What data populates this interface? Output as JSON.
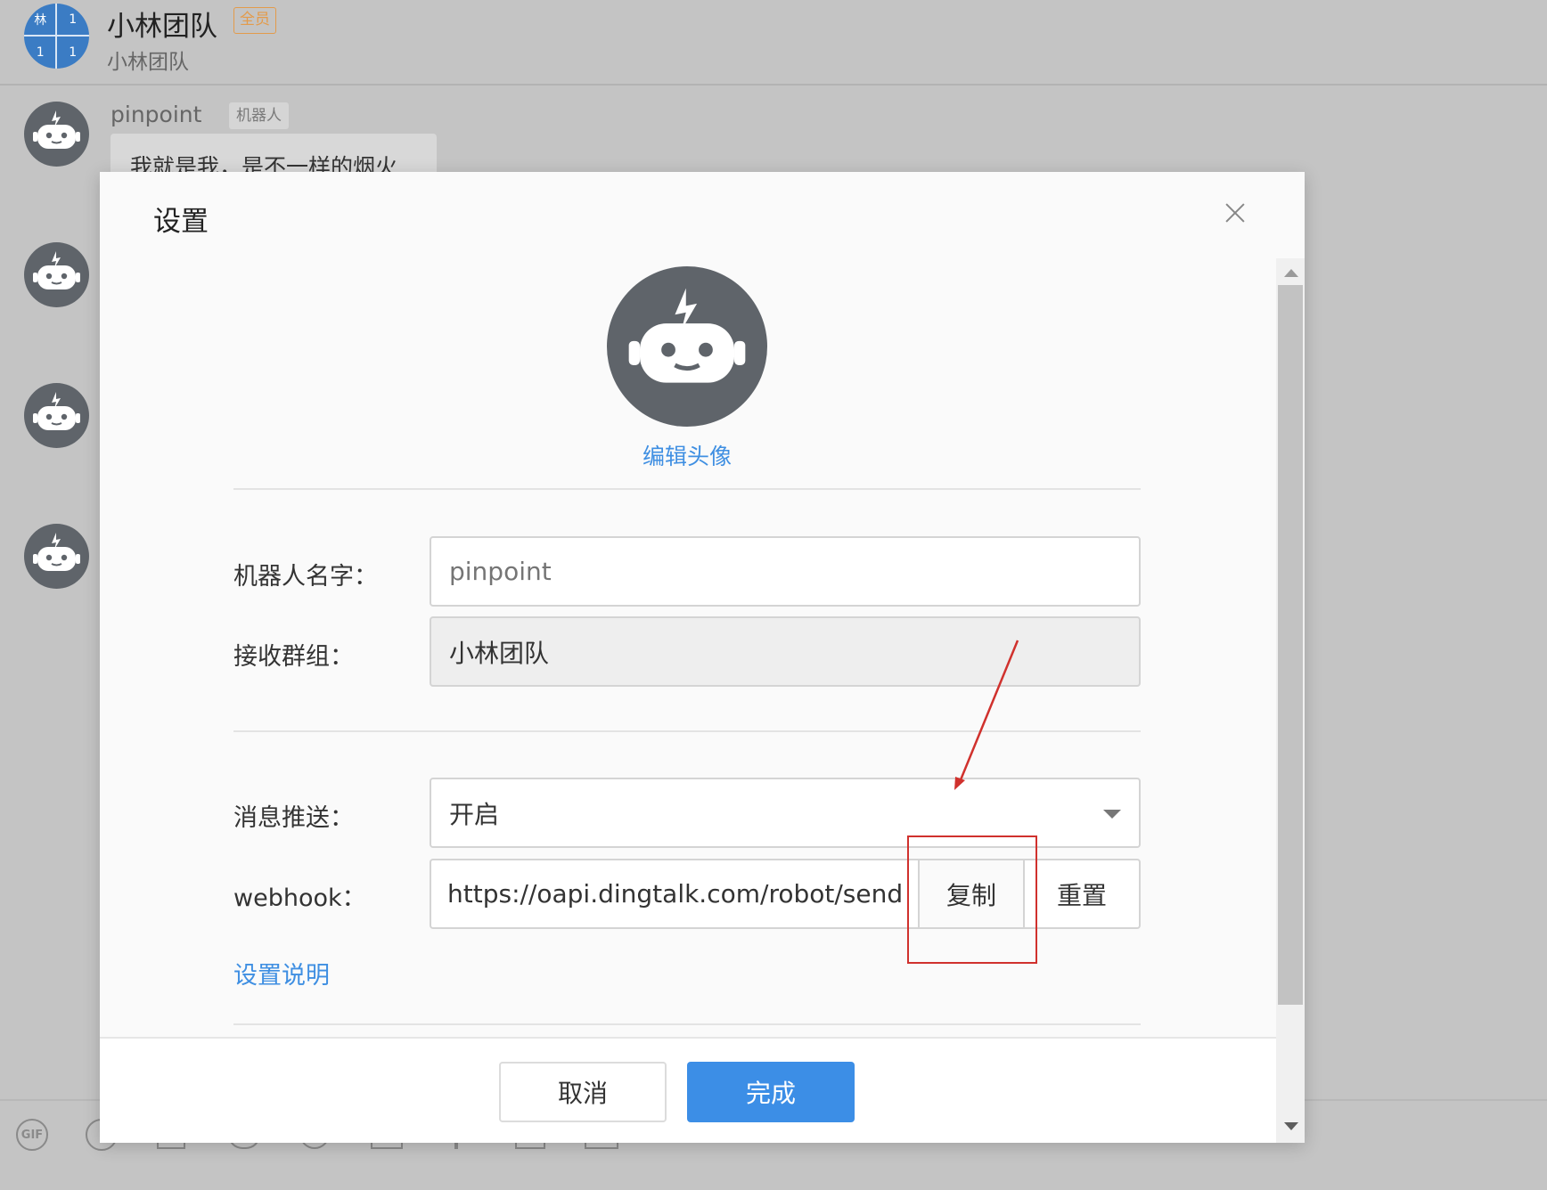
{
  "header": {
    "group_avatar_cells": [
      "林",
      "1",
      "1",
      "1"
    ],
    "title": "小林团队",
    "member_badge": "全员",
    "subtitle": "小林团队"
  },
  "message": {
    "sender": "pinpoint",
    "sender_tag": "机器人",
    "text": "我就是我，是不一样的烟火"
  },
  "toolbar": {
    "gif_label": "GIF"
  },
  "dialog": {
    "title": "设置",
    "edit_avatar": "编辑头像",
    "robot_name": {
      "label": "机器人名字：",
      "placeholder": "pinpoint"
    },
    "receive_group": {
      "label": "接收群组：",
      "value": "小林团队"
    },
    "push": {
      "label": "消息推送：",
      "value": "开启"
    },
    "webhook": {
      "label": "webhook：",
      "value": "https://oapi.dingtalk.com/robot/send",
      "copy": "复制",
      "reset": "重置"
    },
    "help_link": "设置说明",
    "cancel": "取消",
    "done": "完成"
  },
  "colors": {
    "accent_blue": "#3c8ee6",
    "link_blue": "#3f8fe2",
    "annotation_red": "#d0312d",
    "badge_orange": "#e39b4b",
    "avatar_gray": "#5f646a"
  }
}
